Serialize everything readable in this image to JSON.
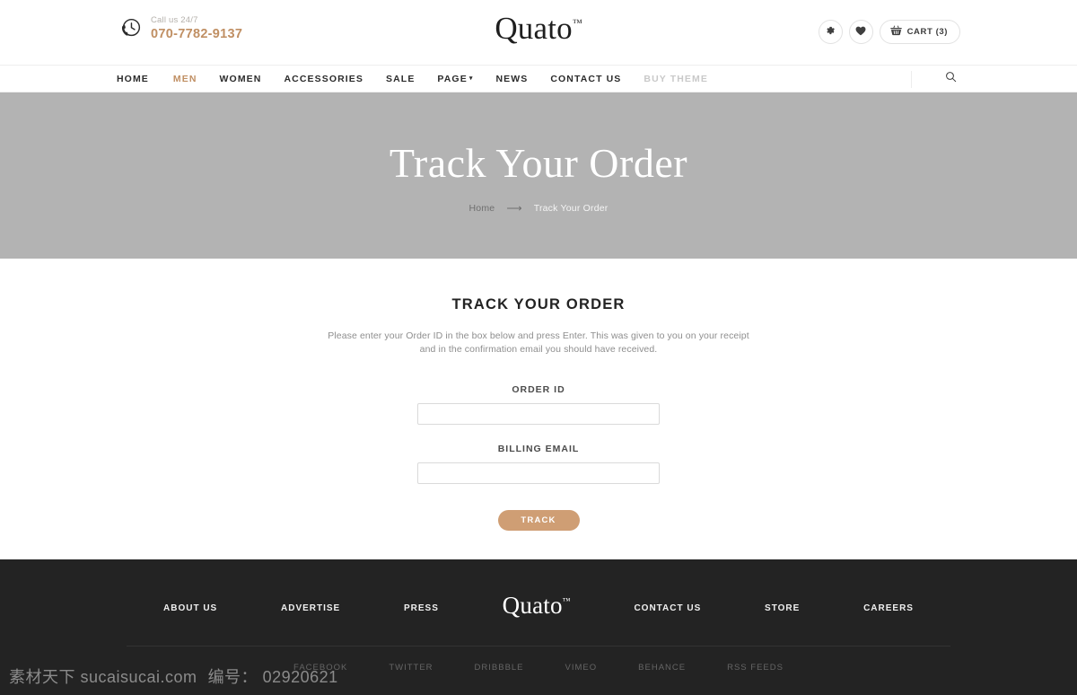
{
  "header": {
    "call_label": "Call us 24/7",
    "call_number": "070-7782-9137",
    "phone_icon": "clock-phone-icon",
    "logo_text": "Quato",
    "logo_tm": "™",
    "actions": {
      "settings_icon": "gear-icon",
      "wishlist_icon": "heart-icon",
      "cart_icon": "cart-basket-icon",
      "cart_label": "CART (3)"
    }
  },
  "nav": {
    "items": [
      {
        "label": "HOME",
        "state": "default"
      },
      {
        "label": "MEN",
        "state": "active"
      },
      {
        "label": "WOMEN",
        "state": "default"
      },
      {
        "label": "ACCESSORIES",
        "state": "default"
      },
      {
        "label": "SALE",
        "state": "default"
      },
      {
        "label": "PAGE",
        "state": "dropdown"
      },
      {
        "label": "NEWS",
        "state": "default"
      },
      {
        "label": "CONTACT US",
        "state": "default"
      },
      {
        "label": "BUY THEME",
        "state": "muted"
      }
    ],
    "dropdown_caret": "▾",
    "search_icon": "search-icon"
  },
  "hero": {
    "title": "Track Your Order",
    "breadcrumb": {
      "home": "Home",
      "arrow": "⟶",
      "current": "Track Your Order"
    },
    "background_color": "#b3b3b3"
  },
  "main": {
    "title": "TRACK YOUR ORDER",
    "description": "Please enter your Order ID in the box below and press Enter. This was given to you on your receipt and in the confirmation email you should have received.",
    "fields": [
      {
        "label": "ORDER ID",
        "value": "",
        "placeholder": ""
      },
      {
        "label": "BILLING EMAIL",
        "value": "",
        "placeholder": ""
      }
    ],
    "submit_label": "TRACK",
    "submit_color": "#cf9e74"
  },
  "footer": {
    "links_left": [
      "ABOUT US",
      "ADVERTISE",
      "PRESS"
    ],
    "logo_text": "Quato",
    "logo_tm": "™",
    "links_right": [
      "CONTACT US",
      "STORE",
      "CAREERS"
    ],
    "social": [
      "FACEBOOK",
      "TWITTER",
      "DRIBBBLE",
      "VIMEO",
      "BEHANCE",
      "RSS FEEDS"
    ],
    "background_color": "#232323"
  },
  "watermark": {
    "site": "素材天下 sucaisucai.com",
    "id": "编号： 02920621"
  }
}
